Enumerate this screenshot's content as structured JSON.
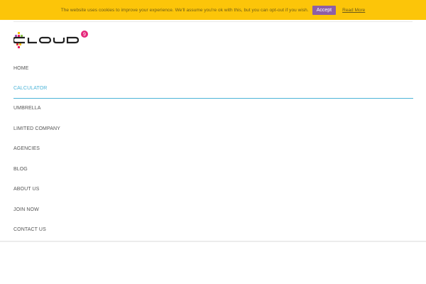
{
  "cookie_bar": {
    "message": "The website uses cookies to improve your experience. We'll assume you're ok with this, but you can opt-out if you wish.",
    "accept_label": "Accept",
    "read_more_label": "Read More",
    "background_color": "#fcc509",
    "accept_color": "#8e5fa6"
  },
  "logo": {
    "text": "CLOUD",
    "badge": "9"
  },
  "nav": {
    "active_color": "#4cb4d8",
    "items": [
      {
        "label": "HOME"
      },
      {
        "label": "CALCULATOR"
      },
      {
        "label": "UMBRELLA"
      },
      {
        "label": "LIMITED COMPANY"
      },
      {
        "label": "AGENCIES"
      },
      {
        "label": "BLOG"
      },
      {
        "label": "ABOUT US"
      },
      {
        "label": "JOIN NOW"
      },
      {
        "label": "CONTACT US"
      }
    ]
  }
}
